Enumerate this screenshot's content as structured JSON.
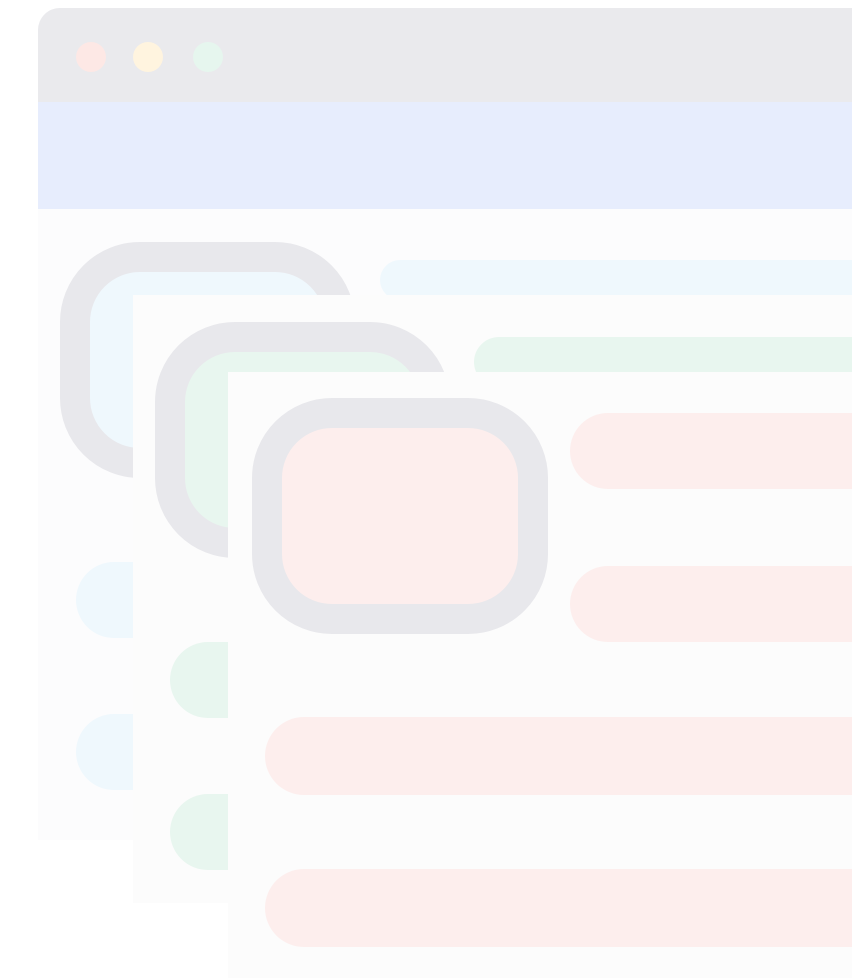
{
  "colors": {
    "titlebar": "#eaeaed",
    "dot_red": "#fde8e5",
    "dot_yellow": "#fff4df",
    "dot_green": "#e6f6ee",
    "banner": "#e7edfd",
    "card_bg": "#fcfcfc",
    "avatar_ring": "#e8e8ec",
    "layer1_fill": "#eff8fd",
    "layer2_fill": "#e8f6ef",
    "layer3_fill": "#fdeeed"
  },
  "icons": {
    "window_controls": [
      "close-dot",
      "minimize-dot",
      "maximize-dot"
    ],
    "avatar": "avatar-placeholder"
  }
}
